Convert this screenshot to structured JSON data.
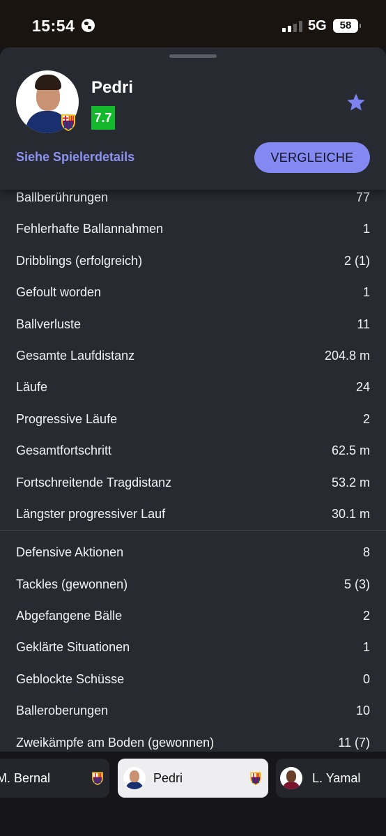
{
  "status_bar": {
    "time": "15:54",
    "network": "5G",
    "battery": "58"
  },
  "player": {
    "name": "Pedri",
    "rating": "7.7",
    "rating_color": "#14b82c",
    "club_crest_icon": "fc-barcelona-crest-icon"
  },
  "actions": {
    "details_link": "Siehe Spielerdetails",
    "compare_button": "VERGLEICHE",
    "favorite_icon": "star-icon",
    "accent_color": "#8389f1"
  },
  "stats": {
    "partial_row": {
      "label": "Ballberührungen",
      "value": "77"
    },
    "possession": [
      {
        "label": "Fehlerhafte Ballannahmen",
        "value": "1"
      },
      {
        "label": "Dribblings (erfolgreich)",
        "value": "2 (1)"
      },
      {
        "label": "Gefoult worden",
        "value": "1"
      },
      {
        "label": "Ballverluste",
        "value": "11"
      },
      {
        "label": "Gesamte Laufdistanz",
        "value": "204.8 m"
      },
      {
        "label": "Läufe",
        "value": "24"
      },
      {
        "label": "Progressive Läufe",
        "value": "2"
      },
      {
        "label": "Gesamtfortschritt",
        "value": "62.5 m"
      },
      {
        "label": "Fortschreitende Tragdistanz",
        "value": "53.2 m"
      },
      {
        "label": "Längster progressiver Lauf",
        "value": "30.1 m"
      }
    ],
    "defense": [
      {
        "label": "Defensive Aktionen",
        "value": "8"
      },
      {
        "label": "Tackles (gewonnen)",
        "value": "5 (3)"
      },
      {
        "label": "Abgefangene Bälle",
        "value": "2"
      },
      {
        "label": "Geklärte Situationen",
        "value": "1"
      },
      {
        "label": "Geblockte Schüsse",
        "value": "0"
      },
      {
        "label": "Balleroberungen",
        "value": "10"
      },
      {
        "label": "Zweikämpfe am Boden (gewonnen)",
        "value": "11 (7)"
      }
    ]
  },
  "switcher": {
    "players": [
      {
        "name": "M. Bernal"
      },
      {
        "name": "Pedri",
        "selected": true
      },
      {
        "name": "L. Yamal"
      }
    ]
  }
}
